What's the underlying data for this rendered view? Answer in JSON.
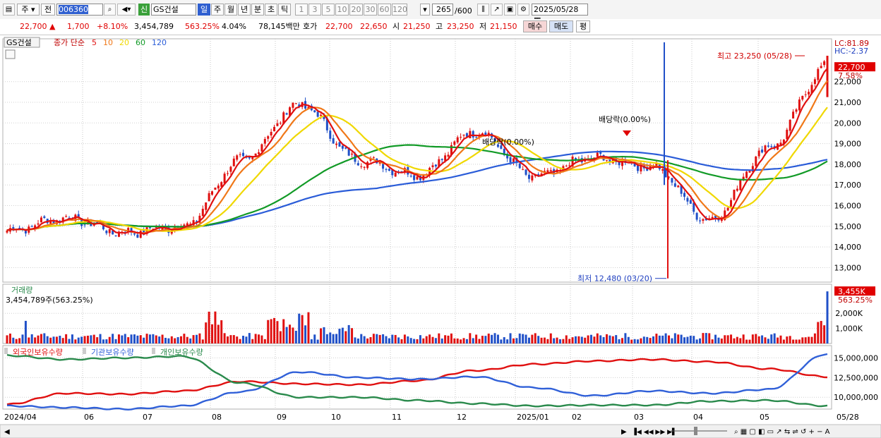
{
  "toolbar": {
    "market_label": "주",
    "prev_label": "전",
    "code": "006360",
    "name": "GS건설",
    "shin_label": "신",
    "period_tabs": [
      "일",
      "주",
      "월",
      "년",
      "분",
      "초",
      "틱"
    ],
    "interval_buttons": [
      "1",
      "3",
      "5",
      "10",
      "20",
      "30",
      "60",
      "120"
    ],
    "count": "265",
    "count_total": "/600",
    "date": "2025/05/28"
  },
  "quote": {
    "price": "22,700",
    "change": "1,700",
    "change_pct": "+8.10%",
    "volume": "3,454,789",
    "volume_pct": "563.25%",
    "turnover": "4.04%",
    "amount": "78,145백만",
    "hoga_label": "호가",
    "ask": "22,700",
    "bid": "22,650",
    "open_label": "시",
    "open": "21,250",
    "high_label": "고",
    "high": "23,250",
    "low_label": "저",
    "low": "21,150",
    "buy_label": "매수",
    "sell_label": "매도",
    "avg_label": "평"
  },
  "legend": {
    "name": "GS건설",
    "price_type": "종가 단순",
    "ma": [
      "5",
      "10",
      "20",
      "60",
      "120"
    ]
  },
  "colors": {
    "ma5": "#e01010",
    "ma10": "#f07818",
    "ma20": "#f0d800",
    "ma60": "#119a26",
    "ma120": "#2a5cd8",
    "up": "#e01010",
    "down": "#2050c8",
    "foreign": "#e01010",
    "institution": "#3060d8",
    "individual": "#2a8a4c"
  },
  "chart_data": [
    {
      "type": "candlestick",
      "title": "GS건설",
      "yticks": [
        "22,000",
        "21,000",
        "20,000",
        "19,000",
        "18,000",
        "17,000",
        "16,000",
        "15,000",
        "14,000",
        "13,000"
      ],
      "ylim": [
        12300,
        23900
      ],
      "x_tick_labels": [
        "2024/04",
        "06",
        "07",
        "08",
        "09",
        "10",
        "11",
        "12",
        "2025/01",
        "02",
        "03",
        "04",
        "05",
        "05/28"
      ],
      "close_anchors": [
        {
          "month": "2024/04",
          "close": 14800
        },
        {
          "month": "2024/05",
          "close": 15400
        },
        {
          "month": "2024/06",
          "close": 14700
        },
        {
          "month": "2024/07",
          "close": 15000
        },
        {
          "month": "2024/08",
          "close": 18200
        },
        {
          "month": "2024/09",
          "close": 20900
        },
        {
          "month": "2024/10",
          "close": 18200
        },
        {
          "month": "2024/11",
          "close": 17500
        },
        {
          "month": "2024/12",
          "close": 19600
        },
        {
          "month": "2025/01",
          "close": 17400
        },
        {
          "month": "2025/02",
          "close": 18300
        },
        {
          "month": "2025/03",
          "close": 17900
        },
        {
          "month": "2025/04",
          "close": 15300
        },
        {
          "month": "2025/05",
          "close": 18800
        },
        {
          "month": "2025/05/28",
          "close": 22700
        }
      ],
      "annotations": {
        "high": "최고 23,250 (05/28)",
        "low": "최저 12,480 (03/20)",
        "dividend1": "배당락(0.00%)",
        "dividend2": "배당락(0.00%)"
      },
      "right_labels": {
        "lc": "LC:81.89",
        "hc": "HC:-2.37",
        "last_price": "22,700",
        "last_pct": "7.58%"
      }
    },
    {
      "type": "bar",
      "title": "거래량",
      "subtitle": "3,454,789주(563.25%)",
      "yticks": [
        "2,000K",
        "1,000K"
      ],
      "last_value": "3,455K",
      "last_pct": "563.25%",
      "highlights_k": [
        {
          "month": "2024/04",
          "value": 1500
        },
        {
          "month": "2024/07",
          "value": 2200
        },
        {
          "month": "2024/08",
          "value": 2050
        },
        {
          "month": "2024/09",
          "value": 1450
        },
        {
          "month": "2025/05/28",
          "value": 3455
        }
      ]
    },
    {
      "type": "line",
      "series": [
        {
          "name": "외국인보유수량",
          "values": [
            9.1,
            10.5,
            10.4,
            10.8,
            12.0,
            11.7,
            11.6,
            12.1,
            13.4,
            14.2,
            14.6,
            14.8,
            14.5,
            13.6,
            12.6
          ]
        },
        {
          "name": "기관보유수량",
          "values": [
            8.9,
            8.7,
            8.5,
            8.9,
            10.7,
            13.2,
            12.5,
            12.3,
            12.6,
            11.2,
            10.2,
            10.8,
            10.5,
            11.0,
            15.5
          ]
        },
        {
          "name": "개인보유수량",
          "values": [
            15.3,
            14.8,
            15.0,
            15.2,
            11.8,
            10.0,
            10.0,
            9.6,
            9.2,
            8.9,
            9.0,
            9.0,
            9.5,
            9.6,
            8.9
          ]
        }
      ],
      "yticks": [
        "15,000,000",
        "12,500,000",
        "10,000,000"
      ]
    }
  ]
}
